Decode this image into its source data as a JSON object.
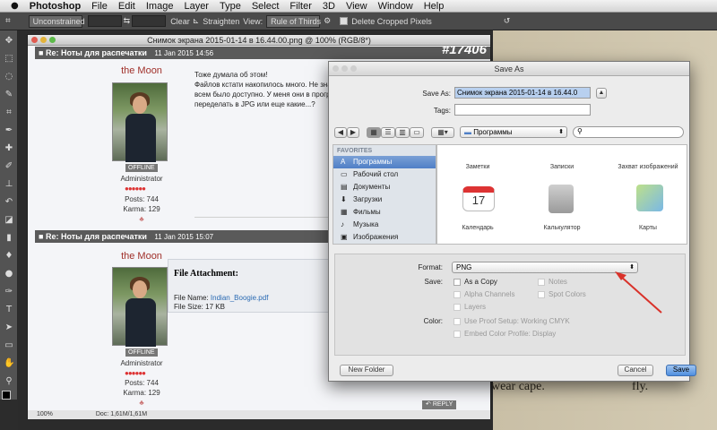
{
  "menubar": {
    "apple": "",
    "items": [
      "Photoshop",
      "File",
      "Edit",
      "Image",
      "Layer",
      "Type",
      "Select",
      "Filter",
      "3D",
      "View",
      "Window",
      "Help"
    ]
  },
  "options_bar": {
    "ratio": "Unconstrained",
    "swap": "⇆",
    "clear": "Clear",
    "straighten": "Straighten",
    "view_label": "View:",
    "view_value": "Rule of Thirds",
    "delete_label": "Delete Cropped Pixels"
  },
  "document": {
    "title": "Снимок экрана 2015-01-14 в 16.44.00.png @ 100% (RGB/8*)",
    "zoom": "100%",
    "doc_size": "Doc: 1,61M/1,61M",
    "posts": [
      {
        "title": "Re: Ноты для распечатки",
        "date": "11 Jan 2015 14:56",
        "number": "#17406",
        "username": "the Moon",
        "status": "OFFLINE",
        "role": "Administrator",
        "posts_label": "Posts: 744",
        "karma_label": "Karma: 129",
        "body_lines": [
          "Тоже думала об этом!",
          "Файлов кстати накопилось много. Не знаю в како",
          "всем было доступно. У меня они в программе M",
          "переделать в JPG или еще какие...?"
        ]
      },
      {
        "title": "Re: Ноты для распечатки",
        "date": "11 Jan 2015 15:07",
        "username": "the Moon",
        "status": "OFFLINE",
        "role": "Administrator",
        "posts_label": "Posts: 744",
        "karma_label": "Karma: 129",
        "attachment": {
          "heading": "File Attachment:",
          "name_label": "File Name:",
          "name_value": "Indian_Boogie.pdf",
          "size_label": "File Size: 17 KB"
        }
      }
    ],
    "reply": "REPLY"
  },
  "dialog": {
    "title": "Save As",
    "save_as_label": "Save As:",
    "save_as_value": "Снимок экрана 2015-01-14 в 16.44.0",
    "tags_label": "Tags:",
    "location": "Программы",
    "search_placeholder": "",
    "sidebar": {
      "favorites": "FAVORITES",
      "items": [
        {
          "icon": "apps-icon",
          "glyph": "A",
          "label": "Программы",
          "selected": true
        },
        {
          "icon": "desktop-icon",
          "glyph": "▭",
          "label": "Рабочий стол"
        },
        {
          "icon": "documents-icon",
          "glyph": "▤",
          "label": "Документы"
        },
        {
          "icon": "downloads-icon",
          "glyph": "⬇",
          "label": "Загрузки"
        },
        {
          "icon": "movies-icon",
          "glyph": "▦",
          "label": "Фильмы"
        },
        {
          "icon": "music-icon",
          "glyph": "♪",
          "label": "Музыка"
        },
        {
          "icon": "pictures-icon",
          "glyph": "▣",
          "label": "Изображения"
        }
      ]
    },
    "apps": [
      "Заметки",
      "Записки",
      "Захват изображений",
      "Календарь",
      "Калькулятор",
      "Карты"
    ],
    "calendar_day": "17",
    "format_label": "Format:",
    "format_value": "PNG",
    "save_label": "Save:",
    "options": {
      "as_copy": "As a Copy",
      "notes": "Notes",
      "alpha": "Alpha Channels",
      "spot": "Spot Colors",
      "layers": "Layers"
    },
    "color_label": "Color:",
    "proof_setup": "Use Proof Setup:  Working CMYK",
    "embed_profile": "Embed Color Profile:  Display",
    "new_folder": "New Folder",
    "cancel": "Cancel",
    "save": "Save"
  },
  "background_text": {
    "left": "wear cape.",
    "right": "fly."
  }
}
